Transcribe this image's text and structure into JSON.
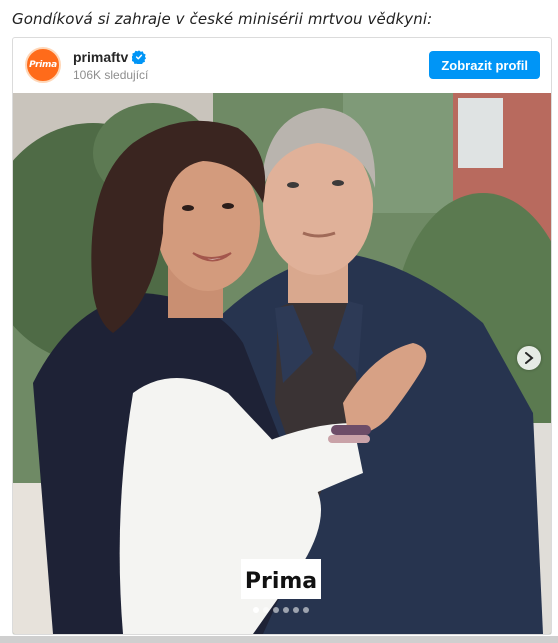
{
  "headline": "Gondíková si zahraje v české minisérii mrtvou vědkyni:",
  "post": {
    "account_name": "primaftv",
    "followers": "106K sledující",
    "follow_label": "Zobrazit profil",
    "avatar_text": "Prima",
    "verified_icon": "verified-badge-icon",
    "watermark_text": "Prima",
    "carousel": {
      "total_slides": 6,
      "current_slide": 1
    }
  },
  "colors": {
    "accent": "#0095f6",
    "brand": "#ff6b1a"
  }
}
